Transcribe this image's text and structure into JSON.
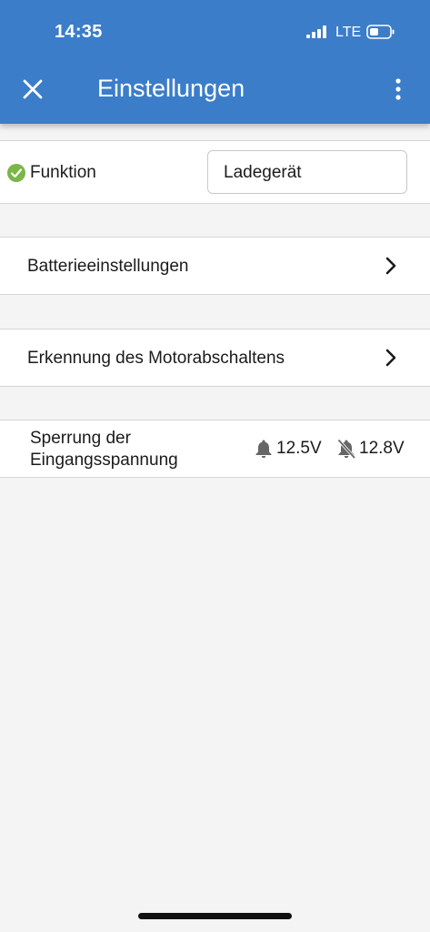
{
  "status_bar": {
    "time": "14:35",
    "network": "LTE"
  },
  "app_bar": {
    "title": "Einstellungen"
  },
  "settings": {
    "function": {
      "label": "Funktion",
      "value": "Ladegerät"
    },
    "battery_settings": {
      "label": "Batterieeinstellungen"
    },
    "engine_shutdown_detection": {
      "label": "Erkennung des Motorabschaltens"
    },
    "input_voltage_lock": {
      "label_line1": "Sperrung der",
      "label_line2": "Eingangsspannung",
      "alarm_on_value": "12.5V",
      "alarm_off_value": "12.8V"
    }
  },
  "colors": {
    "app_bar": "#3b7dc9",
    "check": "#7ab648",
    "background": "#f4f4f4"
  },
  "icons": [
    "close-icon",
    "more-vert-icon",
    "check-circle-icon",
    "chevron-right-icon",
    "bell-icon",
    "bell-off-icon"
  ]
}
